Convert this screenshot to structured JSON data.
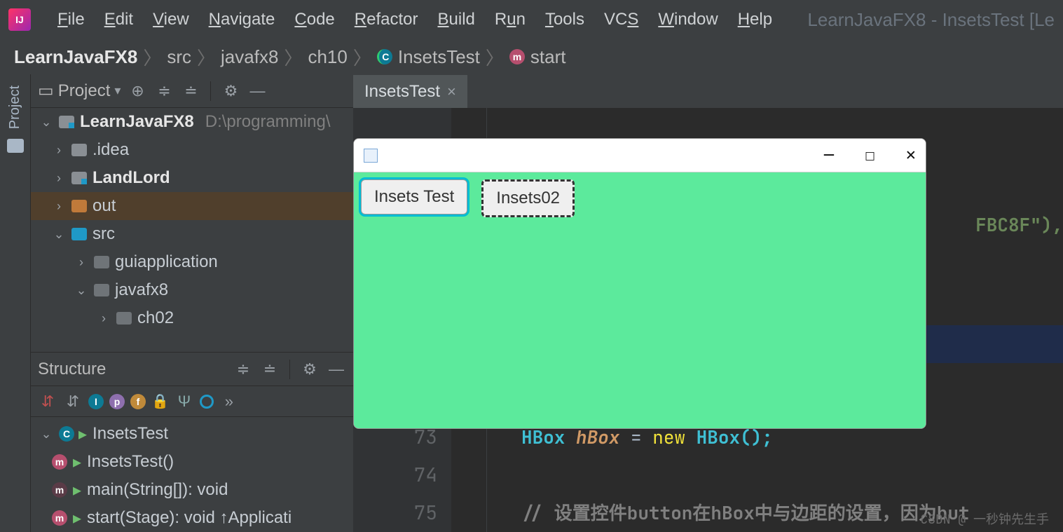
{
  "window_title": "LearnJavaFX8 - InsetsTest [Le",
  "menubar": [
    "File",
    "Edit",
    "View",
    "Navigate",
    "Code",
    "Refactor",
    "Build",
    "Run",
    "Tools",
    "VCS",
    "Window",
    "Help"
  ],
  "breadcrumbs": {
    "root": "LearnJavaFX8",
    "parts": [
      "src",
      "javafx8",
      "ch10"
    ],
    "class_": "InsetsTest",
    "method": "start"
  },
  "project_panel": {
    "title": "Project",
    "tree": {
      "root": {
        "name": "LearnJavaFX8",
        "path": "D:\\programming\\"
      },
      "idea": ".idea",
      "landlord": "LandLord",
      "out": "out",
      "src": "src",
      "guiapplication": "guiapplication",
      "javafx8": "javafx8",
      "ch02": "ch02"
    }
  },
  "structure_panel": {
    "title": "Structure",
    "class_": "InsetsTest",
    "methods": [
      "InsetsTest()",
      "main(String[]): void",
      "start(Stage): void ↑Applicati"
    ]
  },
  "editor": {
    "tab": "InsetsTest",
    "lines": [
      "73",
      "74",
      "75"
    ],
    "code73": {
      "type": "HBox",
      "var": "hBox",
      "new": "new",
      "ctor": "HBox();"
    },
    "code75_comment": "//  设置控件button在hBox中与边距的设置，因为but",
    "snippet_right": "FBC8F\"),"
  },
  "fx": {
    "btn1": "Insets Test",
    "btn2": "Insets02",
    "bg": "#5cea9c"
  },
  "misc": {
    "watermark": "CSDN @ 一秒钟先生手"
  },
  "gutter_label": "Project"
}
